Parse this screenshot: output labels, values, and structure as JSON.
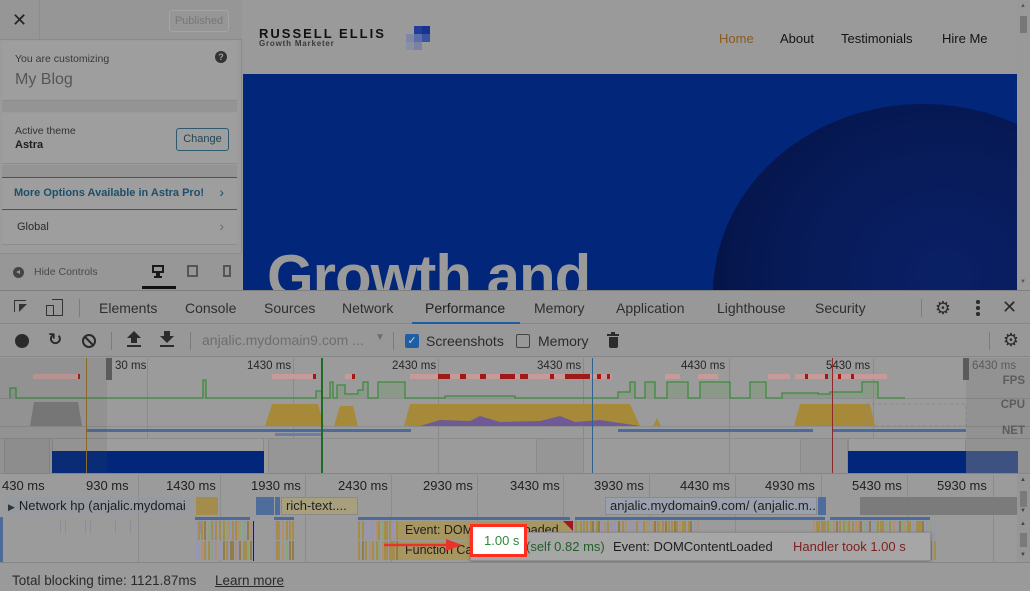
{
  "customizer": {
    "close_label": "✕",
    "status_button": "Published",
    "customizing_label": "You are customizing",
    "site_name": "My Blog",
    "help_icon": "?",
    "active_theme_label": "Active theme",
    "active_theme_value": "Astra",
    "change_button": "Change",
    "sections": [
      {
        "label": "More Options Available in Astra Pro!",
        "chevron": "›"
      },
      {
        "label": "Global",
        "chevron": "›"
      }
    ],
    "hide_controls": "Hide Controls",
    "devices": [
      "desktop",
      "tablet",
      "mobile"
    ],
    "active_device": "desktop"
  },
  "site": {
    "brand_name": "RUSSELL ELLIS",
    "brand_tagline": "Growth Marketer",
    "nav": [
      {
        "label": "Home",
        "active": true
      },
      {
        "label": "About",
        "active": false
      },
      {
        "label": "Testimonials",
        "active": false
      },
      {
        "label": "Hire Me",
        "active": false
      }
    ],
    "hero_title": "Growth and",
    "colors": {
      "hero_bg": "#01267a",
      "nav_active": "#8a5a1f"
    }
  },
  "devtools": {
    "tabs": [
      "Elements",
      "Console",
      "Sources",
      "Network",
      "Performance",
      "Memory",
      "Application",
      "Lighthouse",
      "Security"
    ],
    "active_tab": "Performance",
    "toolbar": {
      "profile_select": "anjalic.mydomain9.com ...",
      "screenshots_label": "Screenshots",
      "screenshots_checked": true,
      "memory_label": "Memory",
      "memory_checked": false
    },
    "overview": {
      "ticks": [
        "30 ms",
        "1430 ms",
        "2430 ms",
        "3430 ms",
        "4430 ms",
        "5430 ms",
        "6430 ms"
      ],
      "row_labels": [
        "FPS",
        "CPU",
        "NET"
      ]
    },
    "flame": {
      "ticks": [
        "430 ms",
        "930 ms",
        "1430 ms",
        "1930 ms",
        "2430 ms",
        "2930 ms",
        "3430 ms",
        "3930 ms",
        "4430 ms",
        "4930 ms",
        "5430 ms",
        "5930 ms"
      ],
      "network_label": "Network hp (anjalic.mydomai",
      "network_blocks": [
        "rich-text....",
        "anjalic.mydomain9.com/ (anjalic.m..."
      ],
      "event_label": "Event: DOMContentLoaded",
      "function_label": "Function Call"
    },
    "tooltip": {
      "duration": "1.00 s",
      "self": "(self 0.82 ms)",
      "event": "Event: DOMContentLoaded",
      "warning": "Handler took 1.00 s"
    },
    "footer": {
      "total_blocking": "Total blocking time: 1121.87ms",
      "learn_more": "Learn more"
    }
  }
}
